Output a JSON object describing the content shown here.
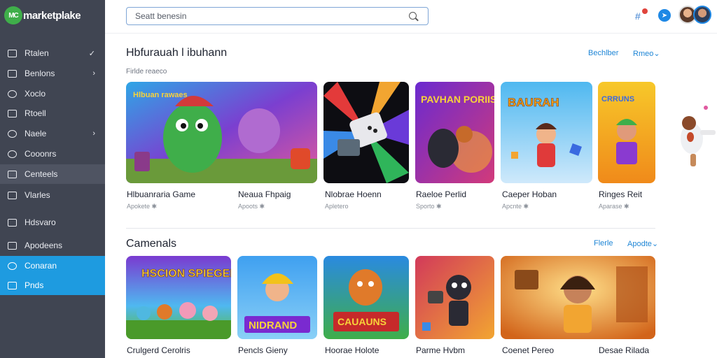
{
  "app": {
    "logo_mark": "MC",
    "logo_text": "marketplake"
  },
  "sidebar": {
    "items": [
      {
        "label": "Rtalen",
        "icon": "tag-icon",
        "chevron": "✓"
      },
      {
        "label": "Benlons",
        "icon": "square-icon",
        "chevron": "›"
      },
      {
        "label": "Xoclo",
        "icon": "circle-icon",
        "chevron": ""
      },
      {
        "label": "Rtoell",
        "icon": "box-icon",
        "chevron": ""
      },
      {
        "label": "Naele",
        "icon": "chat-icon",
        "chevron": "›"
      },
      {
        "label": "Cooonrs",
        "icon": "person-icon",
        "chevron": ""
      },
      {
        "label": "Centeels",
        "icon": "card-icon",
        "chevron": ""
      },
      {
        "label": "Vlarles",
        "icon": "bookmark-icon",
        "chevron": ""
      },
      {
        "label": "Hdsvaro",
        "icon": "list-icon",
        "chevron": ""
      },
      {
        "label": "Apodeens",
        "icon": "image-icon",
        "chevron": ""
      },
      {
        "label": "Conaran",
        "icon": "globe-icon",
        "chevron": ""
      },
      {
        "label": "Pnds",
        "icon": "grid-icon",
        "chevron": ""
      }
    ]
  },
  "topbar": {
    "search_placeholder": "Seatt benesin",
    "icons": [
      "search-icon",
      "grid-icon",
      "message-icon",
      "avatar",
      "avatar"
    ]
  },
  "sections": [
    {
      "title": "Hbfurauah l ibuhann",
      "subtitle": "Firlde reaeco",
      "links": [
        "Bechlber",
        "Rmeo⌄"
      ],
      "items": [
        {
          "title": "Hlbuanraria Game",
          "sub": "Apokete ✱",
          "art": "Hlbuan rawaes"
        },
        {
          "title": "Neaua Fhpaig",
          "sub": "Apoots ✱",
          "art": ""
        },
        {
          "title": "Nlobrae Hoenn",
          "sub": "Apletero",
          "art": ""
        },
        {
          "title": "Raeloe Perlid",
          "sub": "Sporto ✱",
          "art": "PAVHAN PORIIS"
        },
        {
          "title": "Caeper Hoban",
          "sub": "Apcnte ✱",
          "art": "BAURAH"
        },
        {
          "title": "Ringes Reit",
          "sub": "Aparase ✱",
          "art": "CRRUNS"
        }
      ]
    },
    {
      "title": "Camenals",
      "subtitle": "",
      "links": [
        "Flerle",
        "Apodte⌄"
      ],
      "items": [
        {
          "title": "Crulgerd Cerolris",
          "sub": "",
          "art": "HSCION SPIEGEILS"
        },
        {
          "title": "Pencls Gieny",
          "sub": "",
          "art": "NIDRAND"
        },
        {
          "title": "Hoorae Holote",
          "sub": "",
          "art": "CAUAUNS"
        },
        {
          "title": "Parme Hvbm",
          "sub": "",
          "art": ""
        },
        {
          "title": "Coenet Pereo",
          "sub": "",
          "art": ""
        },
        {
          "title": "Desae Rilada",
          "sub": "",
          "art": ""
        }
      ]
    }
  ],
  "colors": {
    "sidebar_bg": "#404552",
    "active_bg": "#1e9be0",
    "link": "#1f86d6",
    "logo_green": "#3fae4a"
  }
}
